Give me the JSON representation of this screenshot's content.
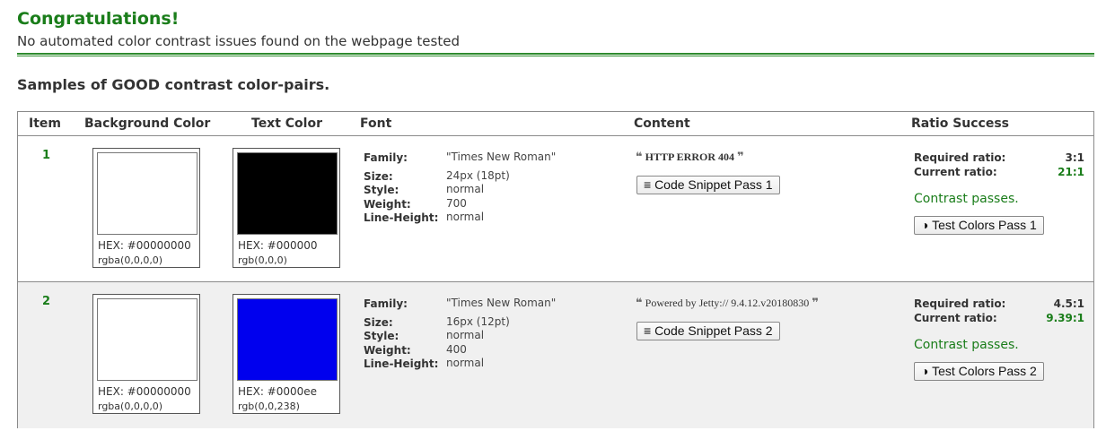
{
  "header": {
    "title": "Congratulations!",
    "subtitle": "No automated color contrast issues found on the webpage tested",
    "samples_title": "Samples of GOOD contrast color-pairs."
  },
  "table": {
    "columns": {
      "item": "Item",
      "background": "Background Color",
      "text": "Text Color",
      "font": "Font",
      "content": "Content",
      "ratio": "Ratio Success"
    },
    "labels": {
      "family": "Family:",
      "size": "Size:",
      "style": "Style:",
      "weight": "Weight:",
      "line_height": "Line-Height:",
      "required": "Required ratio:",
      "current": "Current ratio:"
    },
    "rows": [
      {
        "item": "1",
        "bg_color": "#ffffff",
        "bg_hex": "HEX: #00000000",
        "bg_rgb": "rgba(0,0,0,0)",
        "text_color": "#000000",
        "text_hex": "HEX: #000000",
        "text_rgb": "rgb(0,0,0)",
        "family": "\"Times New Roman\"",
        "size": "24px (18pt)",
        "style": "normal",
        "weight": "700",
        "line_height": "normal",
        "content_text": "HTTP ERROR 404",
        "snippet_button": "Code Snippet Pass 1",
        "required_ratio": "3:1",
        "current_ratio": "21:1",
        "status": "Contrast passes.",
        "test_button": "Test Colors Pass 1"
      },
      {
        "item": "2",
        "bg_color": "#ffffff",
        "bg_hex": "HEX: #00000000",
        "bg_rgb": "rgba(0,0,0,0)",
        "text_color": "#0000ee",
        "text_hex": "HEX: #0000ee",
        "text_rgb": "rgb(0,0,238)",
        "family": "\"Times New Roman\"",
        "size": "16px (12pt)",
        "style": "normal",
        "weight": "400",
        "line_height": "normal",
        "content_text": "Powered by Jetty:// 9.4.12.v20180830",
        "snippet_button": "Code Snippet Pass 2",
        "required_ratio": "4.5:1",
        "current_ratio": "9.39:1",
        "status": "Contrast passes.",
        "test_button": "Test Colors Pass 2"
      }
    ]
  },
  "icons": {
    "quote_open": "❝",
    "quote_close": "❞",
    "snippet": "≡",
    "contrast": "◑"
  }
}
